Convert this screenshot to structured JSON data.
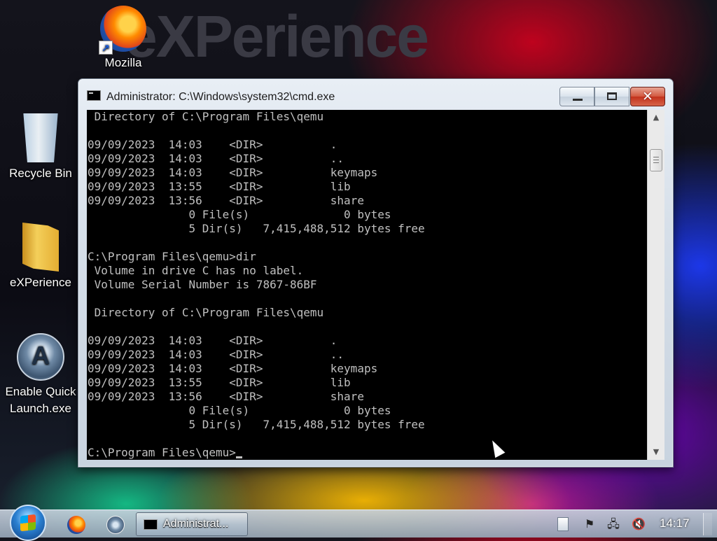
{
  "desktop": {
    "brand_text": "eXPerience",
    "icons": [
      {
        "id": "mozilla",
        "label": "Mozilla"
      },
      {
        "id": "recycle_bin",
        "label": "Recycle Bin"
      },
      {
        "id": "experience",
        "label": "eXPerience"
      },
      {
        "id": "quick_launch",
        "label": "Enable Quick Launch.exe"
      }
    ]
  },
  "window": {
    "title": "Administrator: C:\\Windows\\system32\\cmd.exe",
    "close_glyph": "✕"
  },
  "console": {
    "lines": [
      " Directory of C:\\Program Files\\qemu",
      "",
      "09/09/2023  14:03    <DIR>          .",
      "09/09/2023  14:03    <DIR>          ..",
      "09/09/2023  14:03    <DIR>          keymaps",
      "09/09/2023  13:55    <DIR>          lib",
      "09/09/2023  13:56    <DIR>          share",
      "               0 File(s)              0 bytes",
      "               5 Dir(s)   7,415,488,512 bytes free",
      "",
      "C:\\Program Files\\qemu>dir",
      " Volume in drive C has no label.",
      " Volume Serial Number is 7867-86BF",
      "",
      " Directory of C:\\Program Files\\qemu",
      "",
      "09/09/2023  14:03    <DIR>          .",
      "09/09/2023  14:03    <DIR>          ..",
      "09/09/2023  14:03    <DIR>          keymaps",
      "09/09/2023  13:55    <DIR>          lib",
      "09/09/2023  13:56    <DIR>          share",
      "               0 File(s)              0 bytes",
      "               5 Dir(s)   7,415,488,512 bytes free",
      ""
    ],
    "prompt": "C:\\Program Files\\qemu>"
  },
  "taskbar": {
    "task_label": "Administrat...",
    "clock": "14:17"
  }
}
